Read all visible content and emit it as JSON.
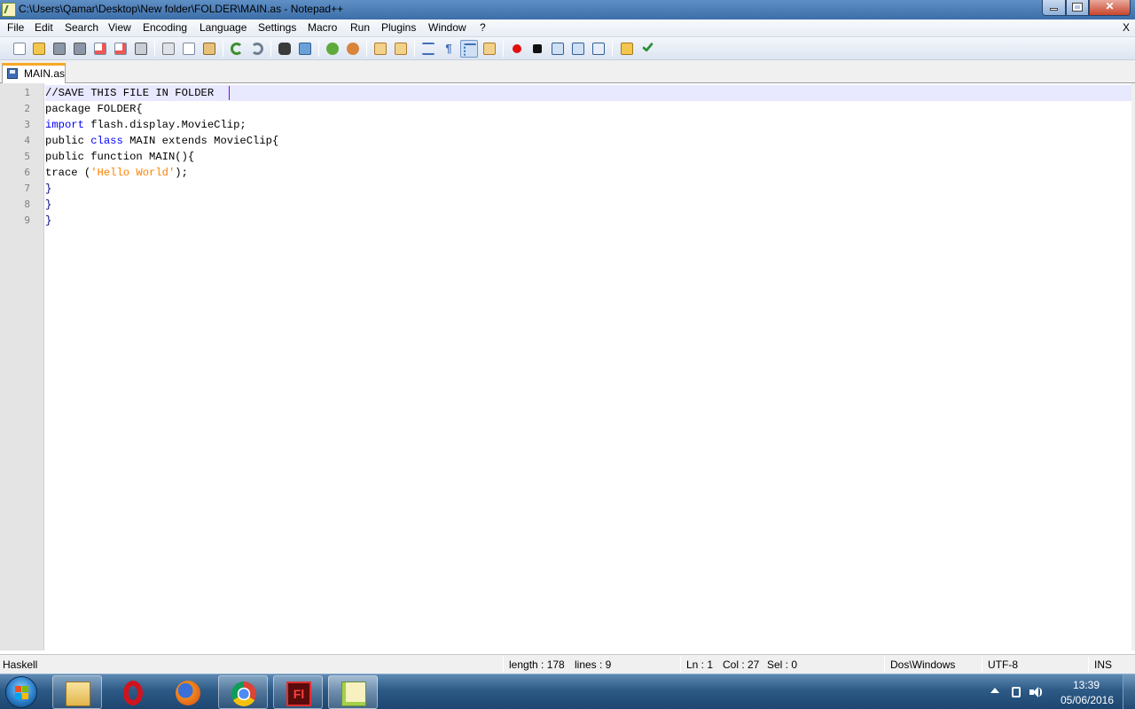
{
  "window": {
    "title": "C:\\Users\\Qamar\\Desktop\\New folder\\FOLDER\\MAIN.as - Notepad++",
    "minimize_glyph": "",
    "close_glyph": "✕"
  },
  "menu": {
    "items": [
      "File",
      "Edit",
      "Search",
      "View",
      "Encoding",
      "Language",
      "Settings",
      "Macro",
      "Run",
      "Plugins",
      "Window",
      "?"
    ],
    "close_doc": "X"
  },
  "toolbar": {
    "buttons": [
      "new-file",
      "open-file",
      "save",
      "save-all",
      "close",
      "close-all",
      "print",
      "cut",
      "copy",
      "paste",
      "undo",
      "redo",
      "find",
      "replace",
      "zoom-in",
      "zoom-out",
      "sync-vertical",
      "sync-horizontal",
      "word-wrap",
      "show-all-chars",
      "indent-guide",
      "doc-map",
      "record-macro",
      "stop-recording",
      "playback-macro",
      "run-macro-multiple",
      "save-macro",
      "open-folder",
      "spell-check"
    ]
  },
  "tabs": [
    {
      "label": "MAIN.as",
      "active": true
    }
  ],
  "editor": {
    "line_numbers": [
      "1",
      "2",
      "3",
      "4",
      "5",
      "6",
      "7",
      "8",
      "9"
    ],
    "lines": [
      "//SAVE THIS FILE IN FOLDER",
      "package FOLDER{",
      "import flash.display.MovieClip;",
      "public class MAIN extends MovieClip{",
      "public function MAIN(){",
      "trace ('Hello World');",
      "}",
      "}",
      "}"
    ],
    "tokens": {
      "l3_kw": "import",
      "l3_rest": " flash.display.MovieClip;",
      "l4_a": "public ",
      "l4_kw": "class",
      "l4_rest": " MAIN extends MovieClip{",
      "l6_a": "trace (",
      "l6_str": "'Hello World'",
      "l6_b": ");"
    }
  },
  "status": {
    "language": "Haskell",
    "length": "length : 178",
    "lines": "lines : 9",
    "ln": "Ln : 1",
    "col": "Col : 27",
    "sel": "Sel : 0",
    "eol": "Dos\\Windows",
    "encoding": "UTF-8",
    "mode": "INS"
  },
  "taskbar": {
    "apps": [
      "file-explorer",
      "opera",
      "firefox",
      "chrome",
      "flash",
      "notepad-plus-plus"
    ],
    "clock_time": "13:39",
    "clock_date": "05/06/2016"
  },
  "colors": {
    "keyword": "#0000ff",
    "string": "#ff8000",
    "current_line": "#e8e8ff",
    "tab_accent": "#f9a825"
  }
}
